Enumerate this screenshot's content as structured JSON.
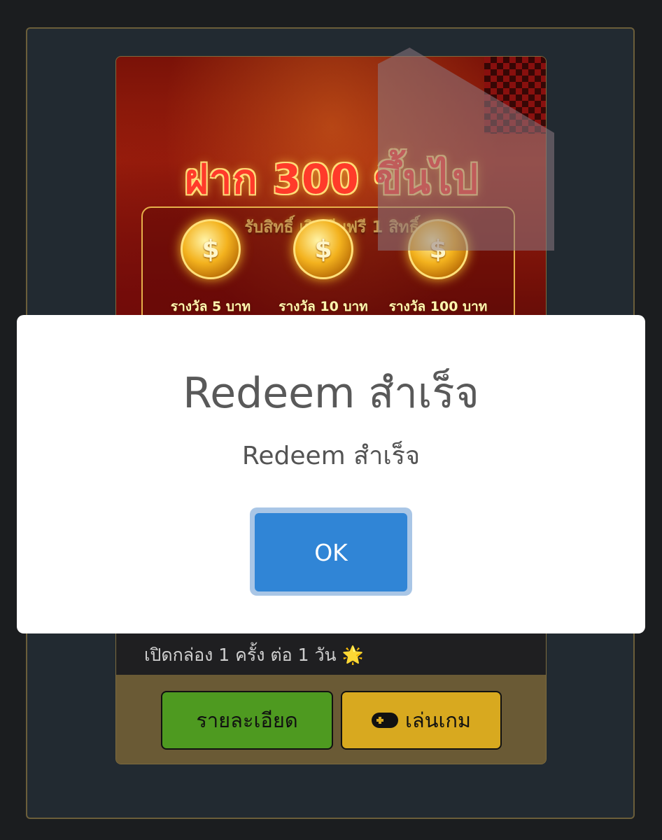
{
  "promo": {
    "headline": "ฝาก 300 ขึ้นไป",
    "subheadline": "รับสิทธิ์ เปิดหีบฟรี 1 สิทธิ์",
    "prizes": [
      {
        "label": "รางวัล 5 บาท",
        "icon": "coin-chest-icon",
        "symbol": "$"
      },
      {
        "label": "รางวัล 10 บาท",
        "icon": "coin-chest-icon",
        "symbol": "$"
      },
      {
        "label": "รางวัล 100 บาท",
        "icon": "coin-chest-icon",
        "symbol": "$"
      }
    ],
    "description_line": "เปิดกล่อง 1 ครั้ง ต่อ 1 วัน 🌟",
    "buttons": {
      "detail_label": "รายละเอียด",
      "play_label": "เล่นเกม",
      "play_icon": "gamepad-icon"
    }
  },
  "dialog": {
    "title": "Redeem สำเร็จ",
    "text": "Redeem สำเร็จ",
    "ok_label": "OK"
  },
  "colors": {
    "page_bg": "#1b1d1f",
    "panel_bg": "#222a31",
    "detail_button": "#4e9a20",
    "play_button": "#d8a91f",
    "ok_button": "#3085d6"
  }
}
